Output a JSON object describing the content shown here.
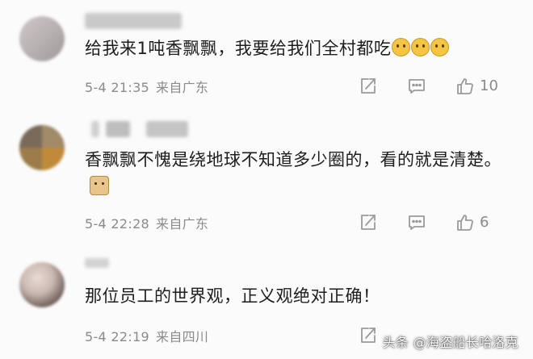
{
  "comments": [
    {
      "username": "",
      "text": "给我来1吨香飘飘，我要给我们全村都吃",
      "emoji": [
        "crying-face",
        "crying-face",
        "crying-face"
      ],
      "date": "5-4 21:35",
      "location": "来自广东",
      "likes": "10"
    },
    {
      "username": "",
      "text": "香飘飘不愧是绕地球不知道多少圈的，看的就是清楚。",
      "emoji": [
        "doge"
      ],
      "date": "5-4 22:28",
      "location": "来自广东",
      "likes": "6"
    },
    {
      "username": "",
      "text": "那位员工的世界观，正义观绝对正确！",
      "date": "5-4 22:19",
      "location": "来自四川"
    }
  ],
  "watermark": "头条 @海盗船长哈洛克",
  "colors": {
    "meta": "#8a8a8a",
    "text": "#1d1d1d",
    "icon": "#9a9a9a"
  }
}
